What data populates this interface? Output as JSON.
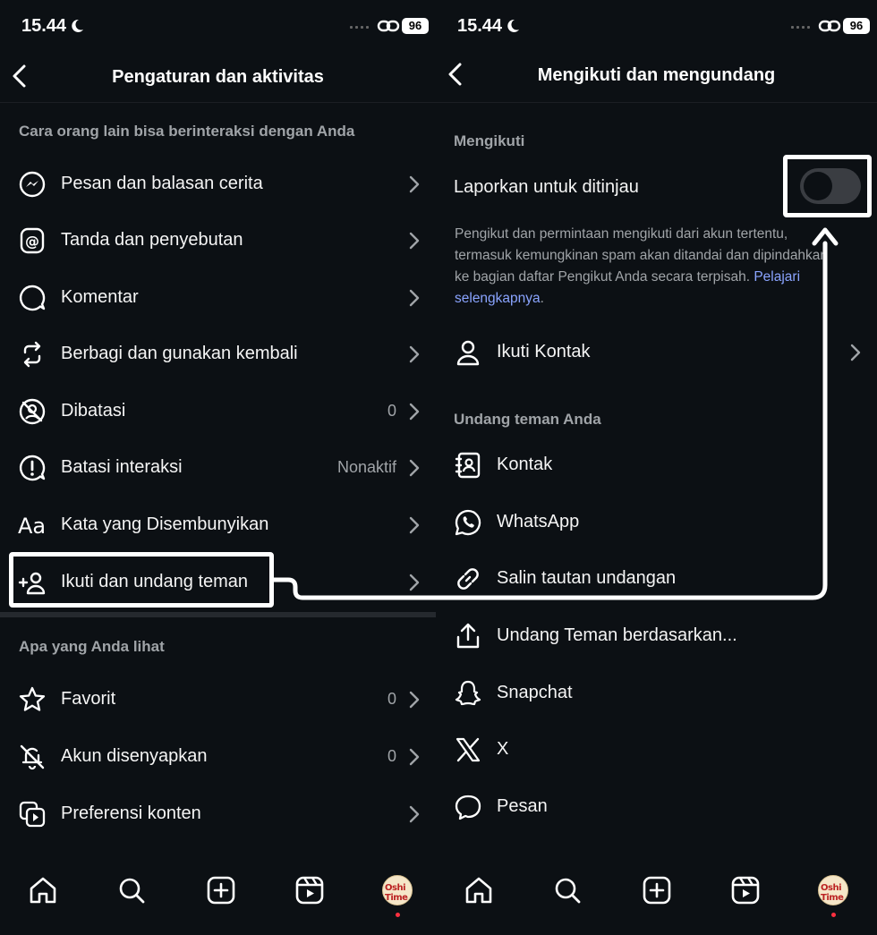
{
  "status": {
    "time": "15.44",
    "battery": "96"
  },
  "left": {
    "title": "Pengaturan dan aktivitas",
    "section1_label": "Cara orang lain bisa berinteraksi dengan Anda",
    "items": [
      {
        "label": "Pesan dan balasan cerita",
        "value": "",
        "icon": "messenger-icon"
      },
      {
        "label": "Tanda dan penyebutan",
        "value": "",
        "icon": "at-icon"
      },
      {
        "label": "Komentar",
        "value": "",
        "icon": "comment-icon"
      },
      {
        "label": "Berbagi dan gunakan kembali",
        "value": "",
        "icon": "share-reuse-icon"
      },
      {
        "label": "Dibatasi",
        "value": "0",
        "icon": "restricted-icon"
      },
      {
        "label": "Batasi interaksi",
        "value": "Nonaktif",
        "icon": "limit-interactions-icon"
      },
      {
        "label": "Kata yang Disembunyikan",
        "value": "",
        "icon": "hidden-words-icon"
      },
      {
        "label": "Ikuti dan undang teman",
        "value": "",
        "icon": "add-friend-icon"
      }
    ],
    "section2_label": "Apa yang Anda lihat",
    "items2": [
      {
        "label": "Favorit",
        "value": "0",
        "icon": "star-icon"
      },
      {
        "label": "Akun disenyapkan",
        "value": "0",
        "icon": "muted-bell-icon"
      },
      {
        "label": "Preferensi konten",
        "value": "",
        "icon": "content-preferences-icon"
      }
    ],
    "hidden_words_glyph": "Aa"
  },
  "right": {
    "title": "Mengikuti dan mengundang",
    "section1_label": "Mengikuti",
    "toggle_label": "Laporkan untuk ditinjau",
    "toggle_on": false,
    "description": "Pengikut dan permintaan mengikuti dari akun tertentu, termasuk kemungkinan spam akan ditandai dan dipindahkan ke bagian daftar Pengikut Anda secara terpisah.",
    "learn_more": "Pelajari selengkapnya",
    "follow_contacts": "Ikuti Kontak",
    "section2_label": "Undang teman Anda",
    "invites": [
      {
        "label": "Kontak",
        "icon": "contacts-book-icon"
      },
      {
        "label": "WhatsApp",
        "icon": "whatsapp-icon"
      },
      {
        "label": "Salin tautan undangan",
        "icon": "link-icon"
      },
      {
        "label": "Undang Teman berdasarkan...",
        "icon": "share-upload-icon"
      },
      {
        "label": "Snapchat",
        "icon": "snapchat-icon"
      },
      {
        "label": "X",
        "icon": "x-icon"
      },
      {
        "label": "Pesan",
        "icon": "message-bubble-icon"
      }
    ]
  },
  "nav": {
    "items": [
      "home-icon",
      "search-icon",
      "create-icon",
      "reels-icon",
      "profile-avatar"
    ],
    "avatar_text": "Oshi Time"
  },
  "colors": {
    "background": "#0c1014",
    "muted": "#a0a4a8",
    "link": "#8aa4ff",
    "highlight": "#ffffff",
    "notification": "#ff3040"
  }
}
